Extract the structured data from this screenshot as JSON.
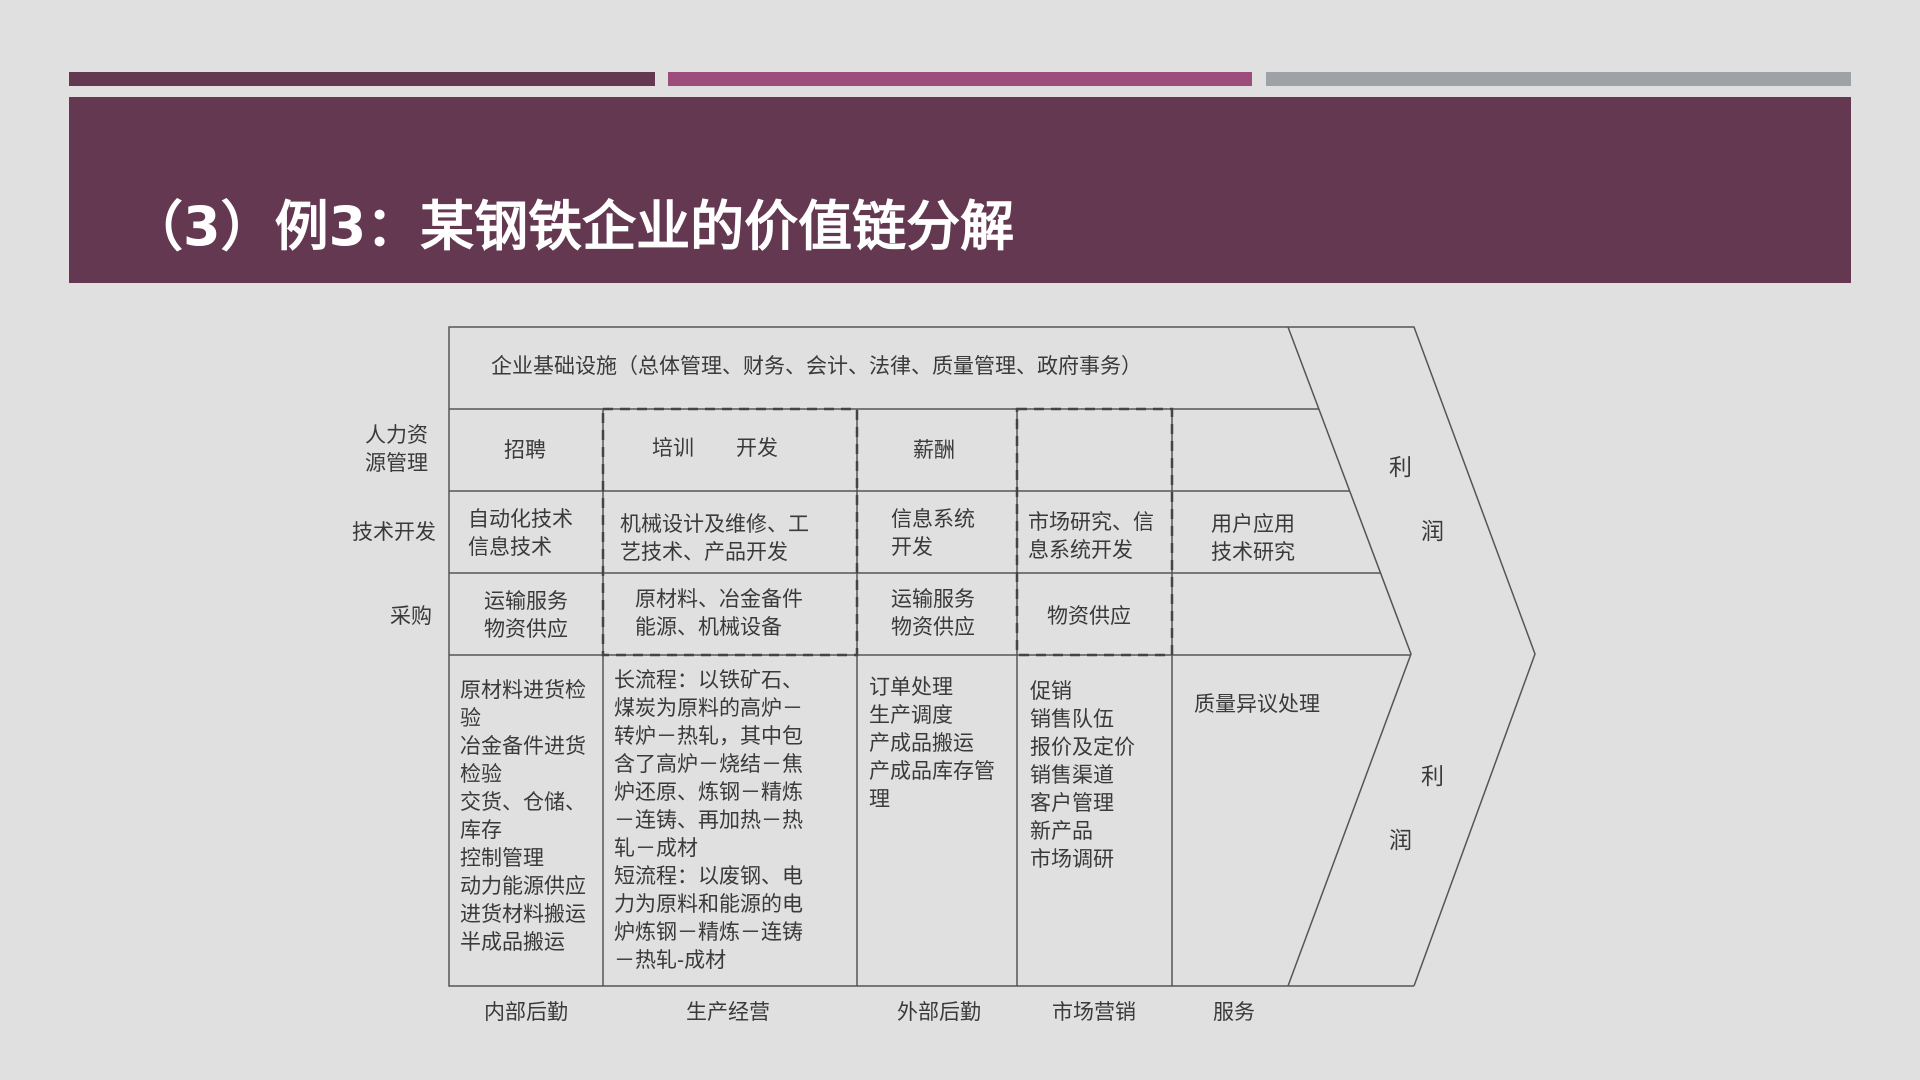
{
  "slide": {
    "title": "（3）例3：某钢铁企业的价值链分解",
    "colors": {
      "background": "#e0e0e0",
      "title_band": "#653852",
      "bar_dark": "#653852",
      "bar_pink": "#9c4d7c",
      "bar_gray": "#9ea2a6",
      "line": "#555555"
    }
  },
  "diagram": {
    "infrastructure": "企业基础设施（总体管理、财务、会计、法律、质量管理、政府事务）",
    "support_rows": [
      {
        "label": "人力资\n源管理",
        "cells": [
          "招聘",
          "培训　　开发",
          "薪酬",
          "",
          ""
        ]
      },
      {
        "label": "技术开发",
        "cells": [
          "自动化技术\n信息技术",
          "机械设计及维修、工\n艺技术、产品开发",
          "信息系统\n开发",
          "市场研究、信\n息系统开发",
          "用户应用\n技术研究"
        ]
      },
      {
        "label": "采购",
        "cells": [
          "运输服务\n物资供应",
          "原材料、冶金备件\n能源、机械设备",
          "运输服务\n物资供应",
          "物资供应",
          ""
        ]
      }
    ],
    "primary_activities": [
      "原材料进货检\n验\n冶金备件进货\n检验\n交货、仓储、\n库存\n控制管理\n动力能源供应\n进货材料搬运\n半成品搬运",
      "长流程：以铁矿石、\n煤炭为原料的高炉－\n转炉－热轧，其中包\n含了高炉－烧结－焦\n炉还原、炼钢－精炼\n－连铸、再加热－热\n轧－成材\n短流程：以废钢、电\n力为原料和能源的电\n炉炼钢－精炼－连铸\n－热轧-成材",
      "订单处理\n生产调度\n产成品搬运\n产成品库存管\n理",
      "促销\n销售队伍\n报价及定价\n销售渠道\n客户管理\n新产品\n市场调研",
      "质量异议处理"
    ],
    "primary_labels": [
      "内部后勤",
      "生产经营",
      "外部后勤",
      "市场营销",
      "服务"
    ],
    "margin_upper": [
      "利",
      "润"
    ],
    "margin_lower": [
      "利",
      "润"
    ]
  }
}
